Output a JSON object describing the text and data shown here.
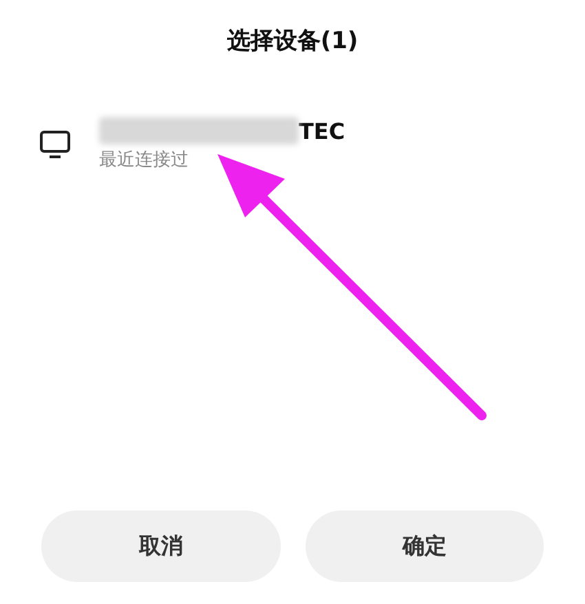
{
  "dialog": {
    "title": "选择设备(1)"
  },
  "devices": [
    {
      "kind": "screen",
      "name": "TEC",
      "redacted": true,
      "status": "最近连接过"
    }
  ],
  "annotation": {
    "kind": "arrow",
    "color": "#ee22ee"
  },
  "buttons": [
    {
      "label": "取消"
    },
    {
      "label": "确定"
    }
  ]
}
